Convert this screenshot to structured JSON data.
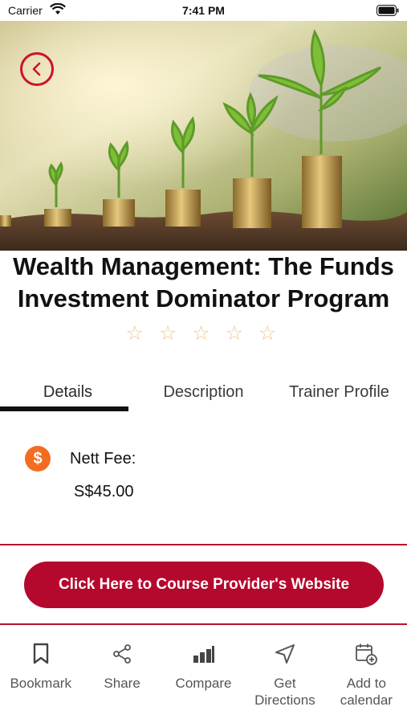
{
  "status_bar": {
    "carrier": "Carrier",
    "time": "7:41 PM"
  },
  "course": {
    "title": "Wealth Management: The Funds Investment Dominator Program",
    "rating_stars": [
      "☆",
      "☆",
      "☆",
      "☆",
      "☆"
    ],
    "rating_value": 0
  },
  "tabs": [
    {
      "label": "Details",
      "active": true
    },
    {
      "label": "Description",
      "active": false
    },
    {
      "label": "Trainer Profile",
      "active": false
    }
  ],
  "details": {
    "fee_icon_symbol": "$",
    "fee_label": "Nett Fee:",
    "fee_value": "S$45.00"
  },
  "cta": {
    "label": "Click Here to Course Provider's Website"
  },
  "bottom_actions": [
    {
      "label": "Bookmark",
      "icon": "bookmark-icon"
    },
    {
      "label": "Share",
      "icon": "share-icon"
    },
    {
      "label": "Compare",
      "icon": "compare-icon"
    },
    {
      "label": "Get Directions",
      "icon": "directions-icon"
    },
    {
      "label": "Add to calendar",
      "icon": "calendar-add-icon"
    }
  ],
  "colors": {
    "accent": "#b5082d",
    "back_button": "#d0112b",
    "fee_icon": "#f26d21",
    "stars": "#f3c68a"
  }
}
